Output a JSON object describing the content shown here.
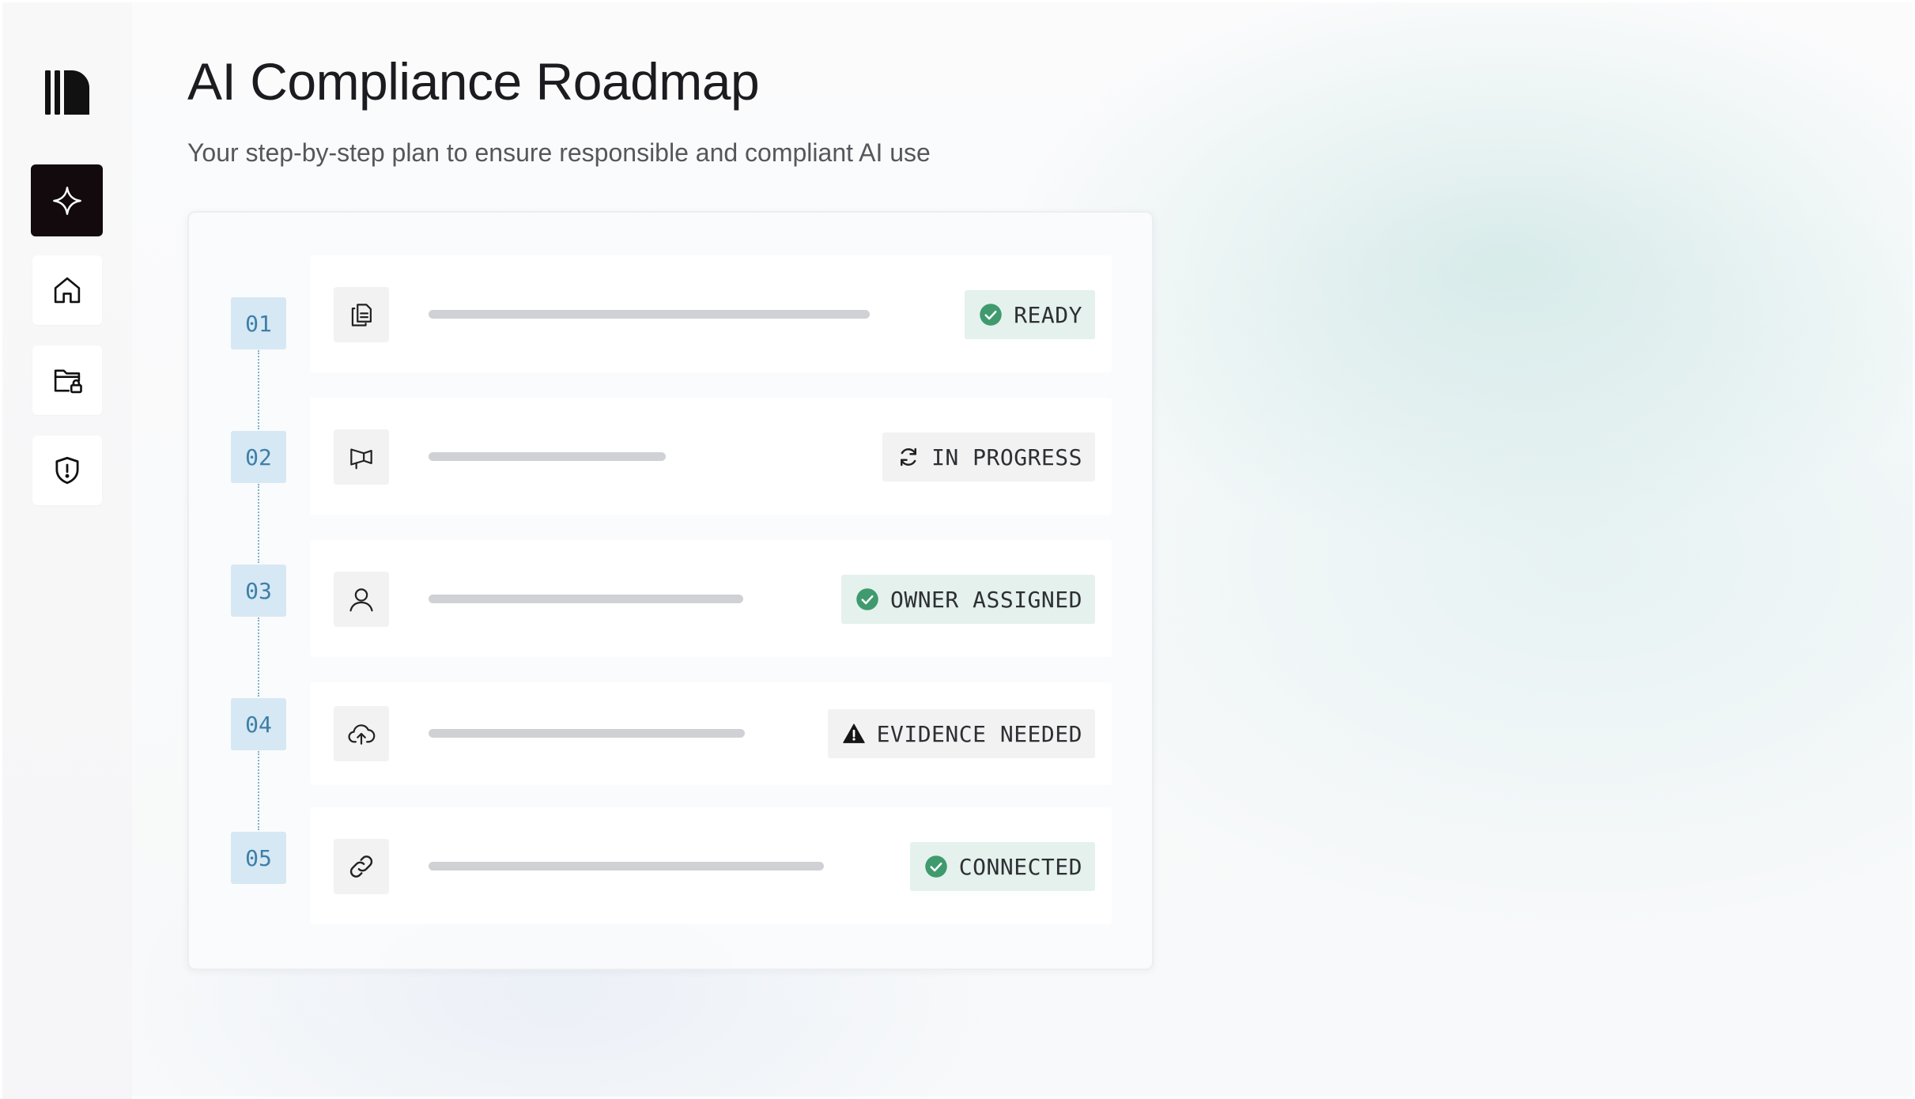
{
  "header": {
    "title": "AI Compliance Roadmap",
    "subtitle": "Your step-by-step plan to ensure responsible and compliant AI use"
  },
  "sidebar": {
    "items": [
      {
        "name": "sparkle-icon",
        "active": true
      },
      {
        "name": "home-icon",
        "active": false
      },
      {
        "name": "folder-lock-icon",
        "active": false
      },
      {
        "name": "shield-alert-icon",
        "active": false
      }
    ]
  },
  "steps": [
    {
      "number": "01",
      "icon": "document-copy-icon",
      "status": "READY",
      "status_icon": "check-circle-icon",
      "status_tone": "green"
    },
    {
      "number": "02",
      "icon": "megaphone-icon",
      "status": "IN PROGRESS",
      "status_icon": "refresh-icon",
      "status_tone": "gray"
    },
    {
      "number": "03",
      "icon": "user-icon",
      "status": "OWNER ASSIGNED",
      "status_icon": "check-circle-icon",
      "status_tone": "green"
    },
    {
      "number": "04",
      "icon": "cloud-upload-icon",
      "status": "EVIDENCE NEEDED",
      "status_icon": "warning-icon",
      "status_tone": "gray"
    },
    {
      "number": "05",
      "icon": "link-icon",
      "status": "CONNECTED",
      "status_icon": "check-circle-icon",
      "status_tone": "green"
    }
  ],
  "colors": {
    "accent_blue": "#3d7fa9",
    "step_bg": "#d6e8f3",
    "success_green": "#3f9a6e",
    "success_bg": "#e4f1ec",
    "active_nav": "#120a0c"
  }
}
